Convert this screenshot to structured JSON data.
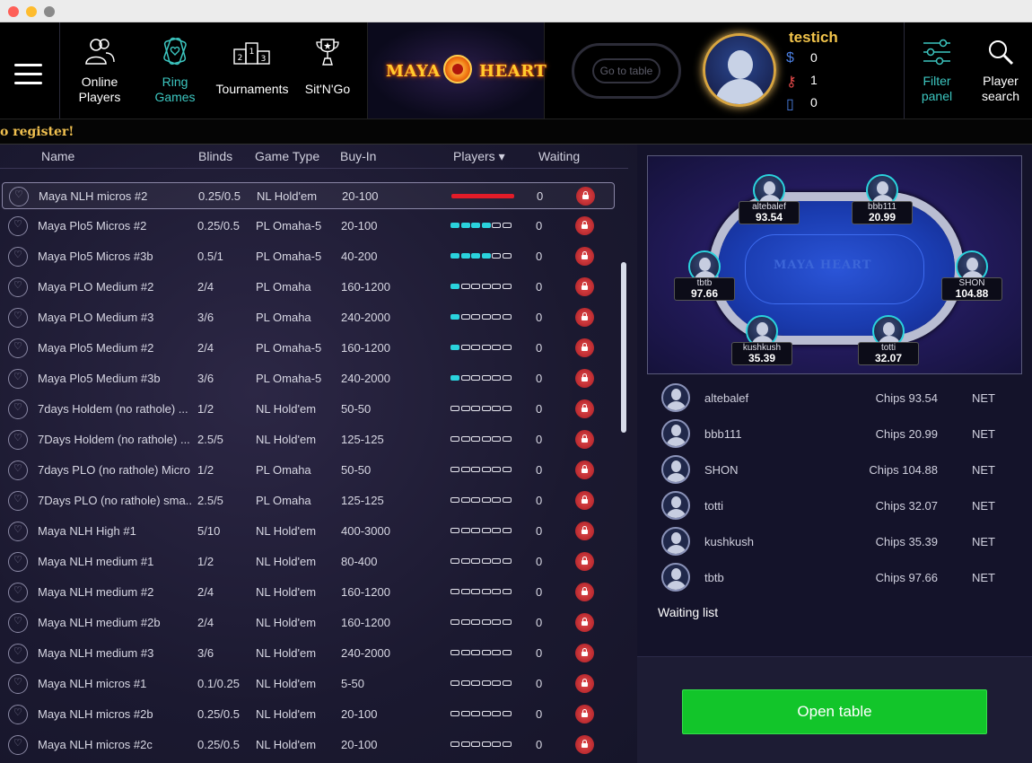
{
  "window": {
    "buttons": [
      "close",
      "minimize",
      "zoom"
    ]
  },
  "nav": {
    "online_players": "Online\nPlayers",
    "ring_games_1": "Ring",
    "ring_games_2": "Games",
    "online_1": "Online",
    "online_2": "Players",
    "tournaments": "Tournaments",
    "sitngo": "Sit'N'Go",
    "filter_1": "Filter",
    "filter_2": "panel",
    "player_search_1": "Player",
    "player_search_2": "search",
    "tournament_icon_digits": [
      "2",
      "1",
      "3"
    ]
  },
  "brand": {
    "left": "MAYA",
    "right": "HEART"
  },
  "go_to_table": "Go to table",
  "user": {
    "name": "testich",
    "dollars": "0",
    "keys": "1",
    "tickets": "0"
  },
  "ticker": "o register!",
  "table_list": {
    "headers": {
      "name": "Name",
      "blinds": "Blinds",
      "game_type": "Game Type",
      "buy_in": "Buy-In",
      "players": "Players ▾",
      "waiting": "Waiting"
    },
    "rows": [
      {
        "name": "Maya NLH micros #2",
        "blinds": "0.25/0.5",
        "game": "NL Hold'em",
        "buyin": "20-100",
        "filled": 6,
        "full": true,
        "waiting": "0",
        "selected": true
      },
      {
        "name": "Maya Plo5 Micros #2",
        "blinds": "0.25/0.5",
        "game": "PL Omaha-5",
        "buyin": "20-100",
        "filled": 4,
        "full": false,
        "waiting": "0"
      },
      {
        "name": "Maya Plo5 Micros #3b",
        "blinds": "0.5/1",
        "game": "PL Omaha-5",
        "buyin": "40-200",
        "filled": 4,
        "full": false,
        "waiting": "0"
      },
      {
        "name": "Maya PLO Medium #2",
        "blinds": "2/4",
        "game": "PL Omaha",
        "buyin": "160-1200",
        "filled": 1,
        "full": false,
        "waiting": "0"
      },
      {
        "name": "Maya PLO Medium #3",
        "blinds": "3/6",
        "game": "PL Omaha",
        "buyin": "240-2000",
        "filled": 1,
        "full": false,
        "waiting": "0"
      },
      {
        "name": "Maya Plo5 Medium #2",
        "blinds": "2/4",
        "game": "PL Omaha-5",
        "buyin": "160-1200",
        "filled": 1,
        "full": false,
        "waiting": "0"
      },
      {
        "name": "Maya Plo5 Medium #3b",
        "blinds": "3/6",
        "game": "PL Omaha-5",
        "buyin": "240-2000",
        "filled": 1,
        "full": false,
        "waiting": "0"
      },
      {
        "name": "7days Holdem (no rathole) ...",
        "blinds": "1/2",
        "game": "NL Hold'em",
        "buyin": "50-50",
        "filled": 0,
        "full": false,
        "waiting": "0"
      },
      {
        "name": "7Days Holdem (no rathole) ...",
        "blinds": "2.5/5",
        "game": "NL Hold'em",
        "buyin": "125-125",
        "filled": 0,
        "full": false,
        "waiting": "0"
      },
      {
        "name": "7days PLO (no rathole) Micro",
        "blinds": "1/2",
        "game": "PL Omaha",
        "buyin": "50-50",
        "filled": 0,
        "full": false,
        "waiting": "0"
      },
      {
        "name": "7Days PLO (no rathole) sma...",
        "blinds": "2.5/5",
        "game": "PL Omaha",
        "buyin": "125-125",
        "filled": 0,
        "full": false,
        "waiting": "0"
      },
      {
        "name": "Maya NLH High #1",
        "blinds": "5/10",
        "game": "NL Hold'em",
        "buyin": "400-3000",
        "filled": 0,
        "full": false,
        "waiting": "0"
      },
      {
        "name": "Maya NLH medium #1",
        "blinds": "1/2",
        "game": "NL Hold'em",
        "buyin": "80-400",
        "filled": 0,
        "full": false,
        "waiting": "0"
      },
      {
        "name": "Maya NLH medium #2",
        "blinds": "2/4",
        "game": "NL Hold'em",
        "buyin": "160-1200",
        "filled": 0,
        "full": false,
        "waiting": "0"
      },
      {
        "name": "Maya NLH medium #2b",
        "blinds": "2/4",
        "game": "NL Hold'em",
        "buyin": "160-1200",
        "filled": 0,
        "full": false,
        "waiting": "0"
      },
      {
        "name": "Maya NLH medium #3",
        "blinds": "3/6",
        "game": "NL Hold'em",
        "buyin": "240-2000",
        "filled": 0,
        "full": false,
        "waiting": "0"
      },
      {
        "name": "Maya NLH micros #1",
        "blinds": "0.1/0.25",
        "game": "NL Hold'em",
        "buyin": "5-50",
        "filled": 0,
        "full": false,
        "waiting": "0"
      },
      {
        "name": "Maya NLH micros #2b",
        "blinds": "0.25/0.5",
        "game": "NL Hold'em",
        "buyin": "20-100",
        "filled": 0,
        "full": false,
        "waiting": "0"
      },
      {
        "name": "Maya NLH micros #2c",
        "blinds": "0.25/0.5",
        "game": "NL Hold'em",
        "buyin": "20-100",
        "filled": 0,
        "full": false,
        "waiting": "0"
      }
    ]
  },
  "preview": {
    "logo": "MAYA   HEART",
    "seats": [
      {
        "name": "altebalef",
        "chips": "93.54"
      },
      {
        "name": "bbb111",
        "chips": "20.99"
      },
      {
        "name": "tbtb",
        "chips": "97.66"
      },
      {
        "name": "SHON",
        "chips": "104.88"
      },
      {
        "name": "kushkush",
        "chips": "35.39"
      },
      {
        "name": "totti",
        "chips": "32.07"
      }
    ]
  },
  "players": [
    {
      "name": "altebalef",
      "chips": "Chips 93.54",
      "net": "NET"
    },
    {
      "name": "bbb111",
      "chips": "Chips 20.99",
      "net": "NET"
    },
    {
      "name": "SHON",
      "chips": "Chips 104.88",
      "net": "NET"
    },
    {
      "name": "totti",
      "chips": "Chips 32.07",
      "net": "NET"
    },
    {
      "name": "kushkush",
      "chips": "Chips 35.39",
      "net": "NET"
    },
    {
      "name": "tbtb",
      "chips": "Chips 97.66",
      "net": "NET"
    }
  ],
  "waiting_list_label": "Waiting list",
  "open_table_label": "Open table",
  "colors": {
    "accent_teal": "#3cc6c0",
    "seat_filled": "#2ad3dd",
    "full_bar": "#e21c28",
    "open_button": "#12c52a",
    "gold": "#f2c44b"
  }
}
